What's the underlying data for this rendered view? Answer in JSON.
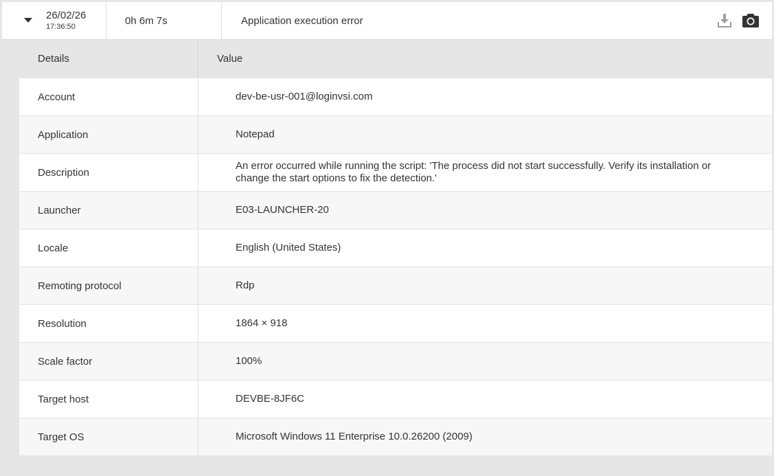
{
  "summary": {
    "date": "26/02/26",
    "time": "17:36:50",
    "duration": "0h 6m 7s",
    "message": "Application execution error"
  },
  "icons": {
    "toggle": "caret-down-icon",
    "download": "download-icon",
    "screenshot": "camera-icon"
  },
  "table": {
    "headers": {
      "key": "Details",
      "value": "Value"
    },
    "rows": [
      {
        "key": "Account",
        "value": "dev-be-usr-001@loginvsi.com"
      },
      {
        "key": "Application",
        "value": "Notepad"
      },
      {
        "key": "Description",
        "value": "An error occurred while running the script: 'The process did not start successfully. Verify its installation or change the start options to fix the detection.'"
      },
      {
        "key": "Launcher",
        "value": "E03-LAUNCHER-20"
      },
      {
        "key": "Locale",
        "value": "English (United States)"
      },
      {
        "key": "Remoting protocol",
        "value": "Rdp"
      },
      {
        "key": "Resolution",
        "value": "1864 × 918"
      },
      {
        "key": "Scale factor",
        "value": "100%"
      },
      {
        "key": "Target host",
        "value": "DEVBE-8JF6C"
      },
      {
        "key": "Target OS",
        "value": "Microsoft Windows 11 Enterprise 10.0.26200 (2009)"
      }
    ]
  },
  "colors": {
    "background": "#e6e6e6",
    "text": "#333333",
    "icon": "#9e9e9e",
    "iconDark": "#333333"
  }
}
